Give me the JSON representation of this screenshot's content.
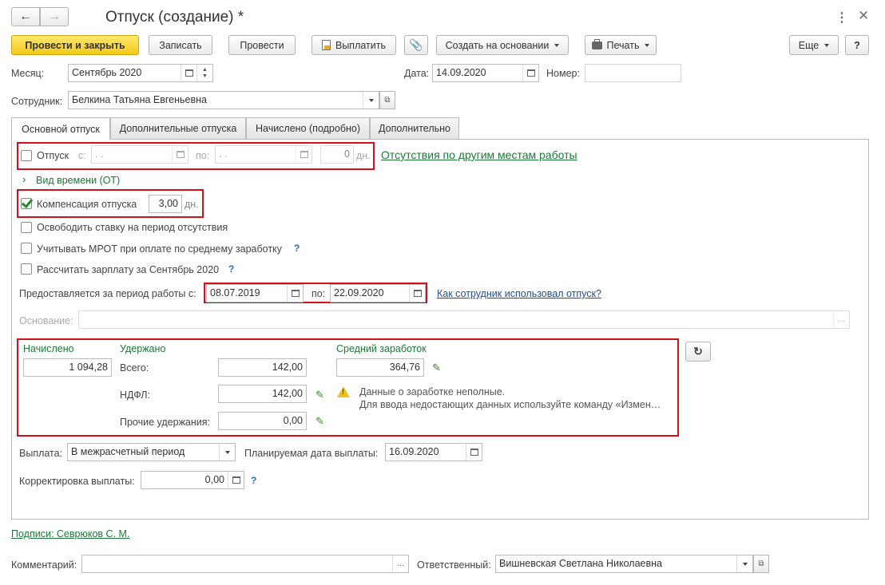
{
  "window": {
    "title": "Отпуск (создание) *"
  },
  "toolbar": {
    "post_close": "Провести и закрыть",
    "save": "Записать",
    "post": "Провести",
    "pay": "Выплатить",
    "create_based": "Создать на основании",
    "print": "Печать",
    "more": "Еще",
    "help": "?"
  },
  "header": {
    "month_label": "Месяц:",
    "month_value": "Сентябрь 2020",
    "date_label": "Дата:",
    "date_value": "14.09.2020",
    "number_label": "Номер:",
    "number_value": "",
    "employee_label": "Сотрудник:",
    "employee_value": "Белкина Татьяна Евгеньевна"
  },
  "tabs": [
    "Основной отпуск",
    "Дополнительные отпуска",
    "Начислено (подробно)",
    "Дополнительно"
  ],
  "main": {
    "vacation_label": "Отпуск",
    "vacation_checked": false,
    "from_label": "с:",
    "from_value": " .  .",
    "to_label": "по:",
    "to_value": " .  .",
    "days_value": "0",
    "days_unit": "дн.",
    "absences_link": "Отсутствия по другим местам работы",
    "time_type": "Вид времени (ОТ)",
    "compensation_label": "Компенсация отпуска",
    "compensation_checked": true,
    "compensation_days": "3,00",
    "compensation_unit": "дн.",
    "release_rate": "Освободить ставку на период отсутствия",
    "mrot": "Учитывать МРОТ при оплате по среднему заработку",
    "calc_salary": "Рассчитать зарплату за Сентябрь 2020",
    "period_label": "Предоставляется за период работы с:",
    "period_from": "08.07.2019",
    "period_to_label": "по:",
    "period_to": "22.09.2020",
    "usage_link": "Как сотрудник использовал отпуск?",
    "basis_label": "Основание:",
    "basis_value": ""
  },
  "calc": {
    "accrued_title": "Начислено",
    "accrued_value": "1 094,28",
    "withheld_title": "Удержано",
    "total_label": "Всего:",
    "total_value": "142,00",
    "ndfl_label": "НДФЛ:",
    "ndfl_value": "142,00",
    "other_label": "Прочие удержания:",
    "other_value": "0,00",
    "avg_title": "Средний заработок",
    "avg_value": "364,76",
    "warning_line1": "Данные о заработке неполные.",
    "warning_line2": "Для ввода недостающих данных используйте команду «Измен…"
  },
  "payment": {
    "label": "Выплата:",
    "value": "В межрасчетный период",
    "planned_label": "Планируемая дата выплаты:",
    "planned_value": "16.09.2020",
    "correction_label": "Корректировка выплаты:",
    "correction_value": "0,00"
  },
  "footer": {
    "signatures_link": "Подписи: Севрюков С. М.",
    "comment_label": "Комментарий:",
    "comment_value": "",
    "responsible_label": "Ответственный:",
    "responsible_value": "Вишневская Светлана Николаевна"
  },
  "colors": {
    "accent": "#f3c919",
    "green": "#1a7a35",
    "highlight": "#d0101a",
    "link_blue": "#1f4e9a"
  }
}
